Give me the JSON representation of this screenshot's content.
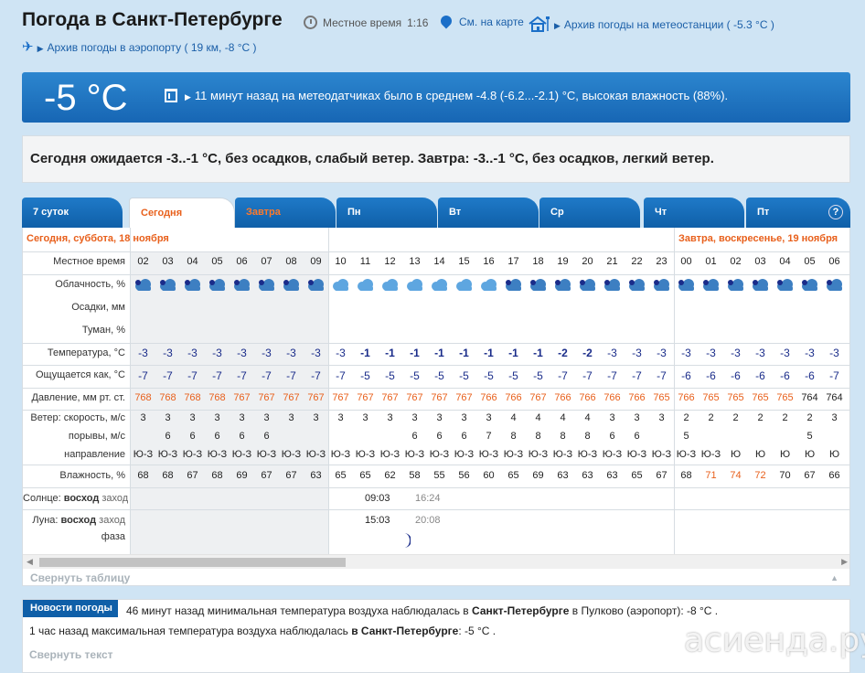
{
  "header": {
    "title": "Погода в Санкт-Петербурге",
    "local_time_label": "Местное время",
    "local_time": "1:16",
    "map_link": "См. на карте",
    "station_link": "Архив погоды на метеостанции ( -5.3 °C )",
    "airport_link": "Архив погоды в аэропорту ( 19 км, -8 °C )"
  },
  "now": {
    "temp": "-5 °C",
    "info": "11 минут назад на метеодатчиках было в среднем -4.8 (-6.2...-2.1) °C, высокая влажность (88%)."
  },
  "forecast_text": "Сегодня ожидается -3..-1 °C, без осадков, слабый ветер. Завтра: -3..-1 °C, без осадков, легкий ветер.",
  "tabs": [
    {
      "label": "7 суток"
    },
    {
      "label": "Сегодня"
    },
    {
      "label": "Завтра"
    },
    {
      "label": "Пн"
    },
    {
      "label": "Вт"
    },
    {
      "label": "Ср"
    },
    {
      "label": "Чт"
    },
    {
      "label": "Пт"
    }
  ],
  "help_label": "?",
  "table": {
    "today_header": "Сегодня, суббота, 18 ноября",
    "tomorrow_header": "Завтра, воскресенье, 19 ноября",
    "row_labels": {
      "time": "Местное время",
      "cloud": "Облачность, %",
      "precip": "Осадки, мм",
      "fog": "Туман, %",
      "temp": "Температура, °C",
      "feel": "Ощущается как, °C",
      "pressure": "Давление, мм рт. ст.",
      "wind_speed": "Ветер: скорость, м/с",
      "gusts": "порывы, м/с",
      "direction": "направление",
      "humidity": "Влажность, %",
      "sun_prefix": "Солнце:",
      "sunrise_word": "восход",
      "sunset_word": "заход",
      "moon_prefix": "Луна:",
      "moonrise_word": "восход",
      "moonset_word": "заход",
      "phase_word": "фаза"
    },
    "hours": [
      "02",
      "03",
      "04",
      "05",
      "06",
      "07",
      "08",
      "09",
      "10",
      "11",
      "12",
      "13",
      "14",
      "15",
      "16",
      "17",
      "18",
      "19",
      "20",
      "21",
      "22",
      "23",
      "00",
      "01",
      "02",
      "03",
      "04",
      "05",
      "06"
    ],
    "temps": [
      "-3",
      "-3",
      "-3",
      "-3",
      "-3",
      "-3",
      "-3",
      "-3",
      "-3",
      "-1",
      "-1",
      "-1",
      "-1",
      "-1",
      "-1",
      "-1",
      "-1",
      "-2",
      "-2",
      "-3",
      "-3",
      "-3",
      "-3",
      "-3",
      "-3",
      "-3",
      "-3",
      "-3",
      "-3"
    ],
    "feels": [
      "-7",
      "-7",
      "-7",
      "-7",
      "-7",
      "-7",
      "-7",
      "-7",
      "-7",
      "-5",
      "-5",
      "-5",
      "-5",
      "-5",
      "-5",
      "-5",
      "-5",
      "-7",
      "-7",
      "-7",
      "-7",
      "-7",
      "-6",
      "-6",
      "-6",
      "-6",
      "-6",
      "-6",
      "-7"
    ],
    "pressure": [
      "768",
      "768",
      "768",
      "768",
      "767",
      "767",
      "767",
      "767",
      "767",
      "767",
      "767",
      "767",
      "767",
      "767",
      "766",
      "766",
      "767",
      "766",
      "766",
      "766",
      "766",
      "765",
      "766",
      "765",
      "765",
      "765",
      "765",
      "764",
      "764"
    ],
    "wind_speed": [
      "3",
      "3",
      "3",
      "3",
      "3",
      "3",
      "3",
      "3",
      "3",
      "3",
      "3",
      "3",
      "3",
      "3",
      "3",
      "4",
      "4",
      "4",
      "4",
      "3",
      "3",
      "3",
      "2",
      "2",
      "2",
      "2",
      "2",
      "2",
      "3"
    ],
    "gusts": [
      "",
      "6",
      "6",
      "6",
      "6",
      "6",
      "",
      "",
      "",
      "",
      "",
      "6",
      "6",
      "6",
      "7",
      "8",
      "8",
      "8",
      "8",
      "6",
      "6",
      "",
      "5",
      "",
      "",
      "",
      "",
      "5",
      ""
    ],
    "direction": [
      "Ю-З",
      "Ю-З",
      "Ю-З",
      "Ю-З",
      "Ю-З",
      "Ю-З",
      "Ю-З",
      "Ю-З",
      "Ю-З",
      "Ю-З",
      "Ю-З",
      "Ю-З",
      "Ю-З",
      "Ю-З",
      "Ю-З",
      "Ю-З",
      "Ю-З",
      "Ю-З",
      "Ю-З",
      "Ю-З",
      "Ю-З",
      "Ю-З",
      "Ю-З",
      "Ю-З",
      "Ю",
      "Ю",
      "Ю",
      "Ю",
      "Ю"
    ],
    "humidity": [
      "68",
      "68",
      "67",
      "68",
      "69",
      "67",
      "67",
      "63",
      "65",
      "65",
      "62",
      "58",
      "55",
      "56",
      "60",
      "65",
      "69",
      "63",
      "63",
      "63",
      "65",
      "67",
      "68",
      "71",
      "74",
      "72",
      "70",
      "67",
      "66"
    ],
    "humidity_highlight": [
      23,
      24,
      25
    ],
    "sunrise": "09:03",
    "sunset": "16:24",
    "moonrise": "15:03",
    "moonset": "20:08",
    "collapse_label": "Свернуть таблицу"
  },
  "news": {
    "tab_label": "Новости погоды",
    "line1_pre": "46 минут назад минимальная температура воздуха наблюдалась в ",
    "line1_city": "Санкт-Петербурге",
    "line1_post": " в Пулково (аэропорт): -8 °C .",
    "line2_pre": "1 час назад максимальная температура воздуха наблюдалась ",
    "line2_city": "в Санкт-Петербурге",
    "line2_post": ": -5 °C .",
    "collapse_label": "Свернуть текст"
  },
  "watermark": "асиенда.ру",
  "icons": {
    "clock": "clock-icon",
    "pin": "map-pin-icon",
    "station": "house-station-icon",
    "plane": "plane-icon",
    "building": "building-icon",
    "cloud": "cloud-moon-icon",
    "moon": "moon-phase-icon"
  }
}
